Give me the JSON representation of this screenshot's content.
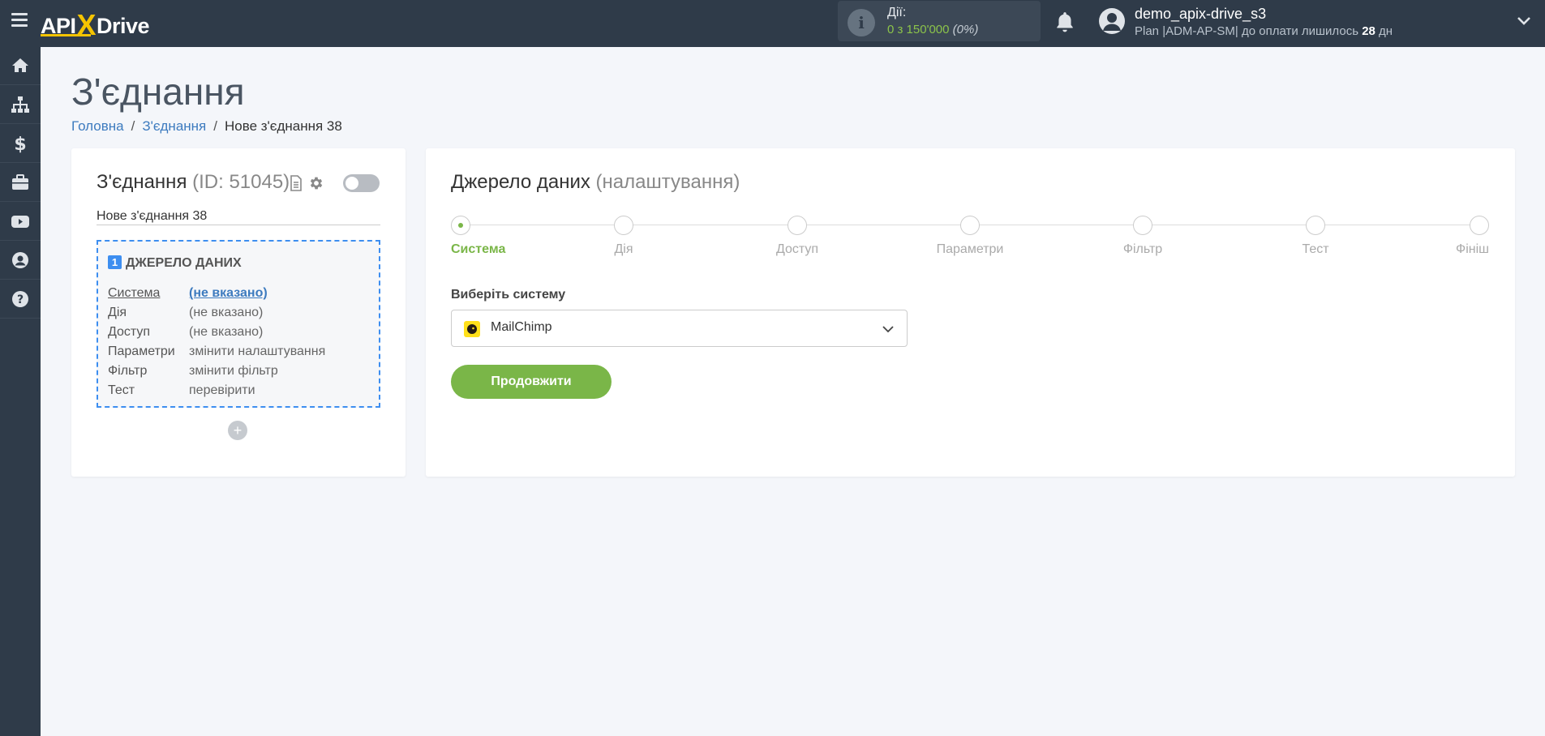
{
  "header": {
    "logo": {
      "left": "API",
      "x": "X",
      "right": "Drive"
    },
    "actions": {
      "label": "Дії:",
      "value": "0 з 150'000",
      "percent": "(0%)"
    },
    "user": {
      "name": "demo_apix-drive_s3",
      "plan_prefix": "Plan |ADM-AP-SM| до оплати лишилось",
      "days": "28",
      "days_unit": "дн"
    }
  },
  "sidebar": {
    "items": [
      {
        "name": "home-icon"
      },
      {
        "name": "sitemap-icon"
      },
      {
        "name": "dollar-icon"
      },
      {
        "name": "briefcase-icon"
      },
      {
        "name": "youtube-icon"
      },
      {
        "name": "user-circle-icon"
      },
      {
        "name": "help-icon"
      }
    ]
  },
  "page": {
    "title": "З'єднання",
    "breadcrumb": [
      "Головна",
      "З'єднання",
      "Нове з'єднання 38"
    ]
  },
  "connection": {
    "title": "З'єднання",
    "id": "(ID: 51045)",
    "name_value": "Нове з'єднання 38",
    "source_number": "1",
    "source_title": "ДЖЕРЕЛО ДАНИХ",
    "rows": [
      {
        "key": "Система",
        "value": "(не вказано)"
      },
      {
        "key": "Дія",
        "value": "(не вказано)"
      },
      {
        "key": "Доступ",
        "value": "(не вказано)"
      },
      {
        "key": "Параметри",
        "value": "змінити налаштування"
      },
      {
        "key": "Фільтр",
        "value": "змінити фільтр"
      },
      {
        "key": "Тест",
        "value": "перевірити"
      }
    ],
    "add_label": "+"
  },
  "source": {
    "title": "Джерело даних",
    "subtitle": "(налаштування)",
    "steps": [
      "Система",
      "Дія",
      "Доступ",
      "Параметри",
      "Фільтр",
      "Тест",
      "Фініш"
    ],
    "active_step": 0,
    "choose_label": "Виберіть систему",
    "selected_system": "MailChimp",
    "continue_label": "Продовжити"
  },
  "colors": {
    "topbar": "#2f3b49",
    "accent_green": "#7ab648",
    "link_blue": "#3d7bbf",
    "dashed_blue": "#3d8ef0",
    "logo_yellow": "#f5c400"
  }
}
